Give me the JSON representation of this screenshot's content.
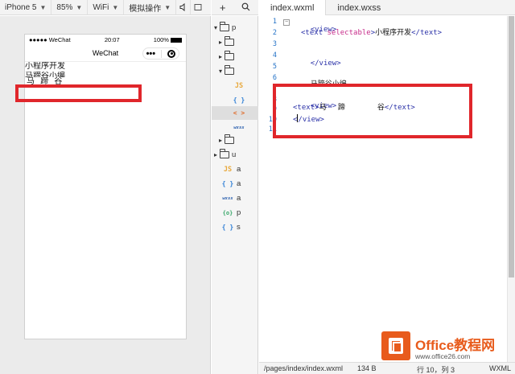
{
  "toolbar": {
    "device": "iPhone 5",
    "zoom": "85%",
    "network": "WiFi",
    "simulate": "模拟操作"
  },
  "phone": {
    "carrier": "●●●●● WeChat",
    "time": "20:07",
    "battery": "100%",
    "nav_title": "WeChat",
    "menu_dots": "•••",
    "lines": [
      "小程序开发",
      "马蹄谷小编",
      "马 蹄 谷"
    ]
  },
  "tree": {
    "icons": {
      "add": "+",
      "search": "search-icon"
    },
    "rows": [
      {
        "kind": "folder-open",
        "label": "p"
      },
      {
        "kind": "folder",
        "label": ""
      },
      {
        "kind": "folder",
        "label": ""
      },
      {
        "kind": "folder-open",
        "label": ""
      },
      {
        "kind": "js",
        "icon": "JS",
        "label": ""
      },
      {
        "kind": "json",
        "icon": "{ }",
        "label": ""
      },
      {
        "kind": "wxml",
        "icon": "< >",
        "label": ""
      },
      {
        "kind": "wxss",
        "icon": "wxss",
        "label": ""
      },
      {
        "kind": "folder",
        "label": ""
      },
      {
        "kind": "folder",
        "label": "u"
      },
      {
        "kind": "js",
        "icon": "JS",
        "label": "a"
      },
      {
        "kind": "json",
        "icon": "{ }",
        "label": "a"
      },
      {
        "kind": "wxss",
        "icon": "wxss",
        "label": "a"
      },
      {
        "kind": "wxs",
        "icon": "{o}",
        "label": "p"
      },
      {
        "kind": "json",
        "icon": "{ }",
        "label": "s"
      }
    ]
  },
  "editor": {
    "tabs": [
      "index.wxml",
      "index.wxss"
    ],
    "line_numbers": [
      "1",
      "2",
      "3",
      "4",
      "5",
      "6",
      "7",
      "8",
      "9",
      "10",
      "11"
    ],
    "code": {
      "l1_open": "<view>",
      "l2_open": "<text",
      "l2_attr": " selectable",
      "l2_gt": ">",
      "l2_text": "小程序开发",
      "l2_close": "</text>",
      "l4_close": "</view>",
      "l6_text": "马蹄谷小编",
      "l8_open": "<view>",
      "l9_open": "<text>",
      "l9_text": "马     蹄              谷",
      "l9_close": "</text>",
      "l10_a": "<",
      "l10_b": "/view>"
    }
  },
  "status": {
    "path": "/pages/index/index.wxml",
    "size": "134 B",
    "position": "行 10，列 3",
    "lang": "WXML"
  },
  "watermark": {
    "title": "Office教程网",
    "url": "www.office26.com"
  },
  "colors": {
    "highlight": "#e0262b",
    "tag": "#2b32a8",
    "attr": "#c72c8a",
    "line_number": "#2573c7",
    "brand": "#e85b1c"
  }
}
